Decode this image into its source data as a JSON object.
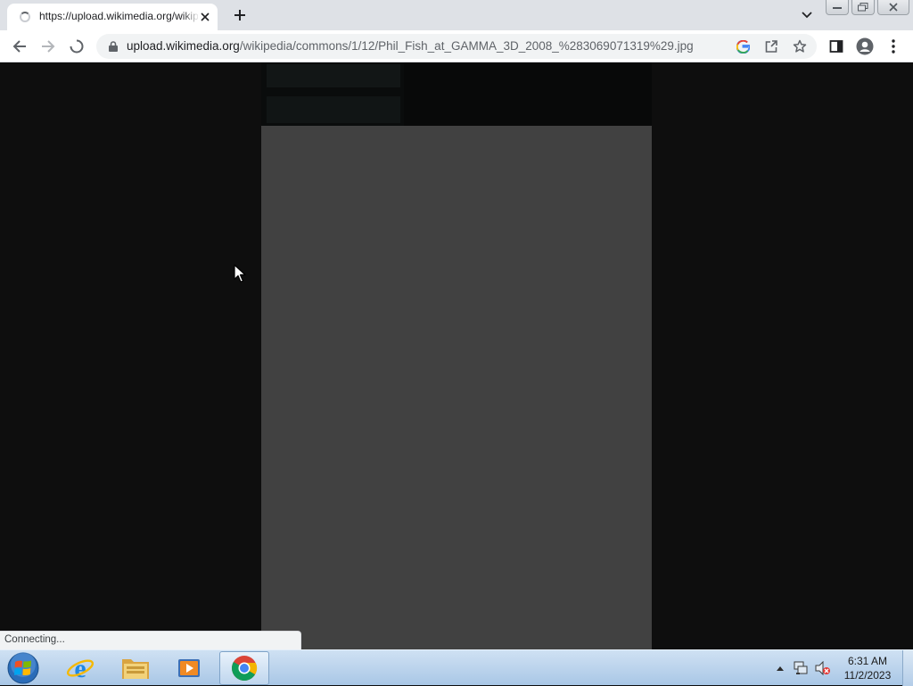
{
  "browser": {
    "tab": {
      "title": "https://upload.wikimedia.org/wikipedia/commons/1/12/Phil_Fish_at_GAMMA_3D_2008_%283069071319%29.jpg"
    },
    "address": {
      "domain": "upload.wikimedia.org",
      "path": "/wikipedia/commons/1/12/Phil_Fish_at_GAMMA_3D_2008_%283069071319%29.jpg"
    },
    "status_text": "Connecting..."
  },
  "icons": {
    "back": "back-arrow-icon",
    "forward": "forward-arrow-icon",
    "stop": "loading-spinner-icon",
    "lock": "lock-icon",
    "google": "google-lens-icon",
    "share": "share-icon",
    "bookmark": "star-icon",
    "sidepanel": "side-panel-icon",
    "profile": "profile-icon",
    "menu": "kebab-menu-icon"
  },
  "taskbar": {
    "clock_time": "6:31 AM",
    "clock_date": "11/2/2023"
  },
  "colors": {
    "page_bg": "#0e0e0e",
    "image_placeholder": "#414141",
    "chrome_tabstrip": "#dee1e6",
    "taskbar": "#bcd4ec"
  }
}
